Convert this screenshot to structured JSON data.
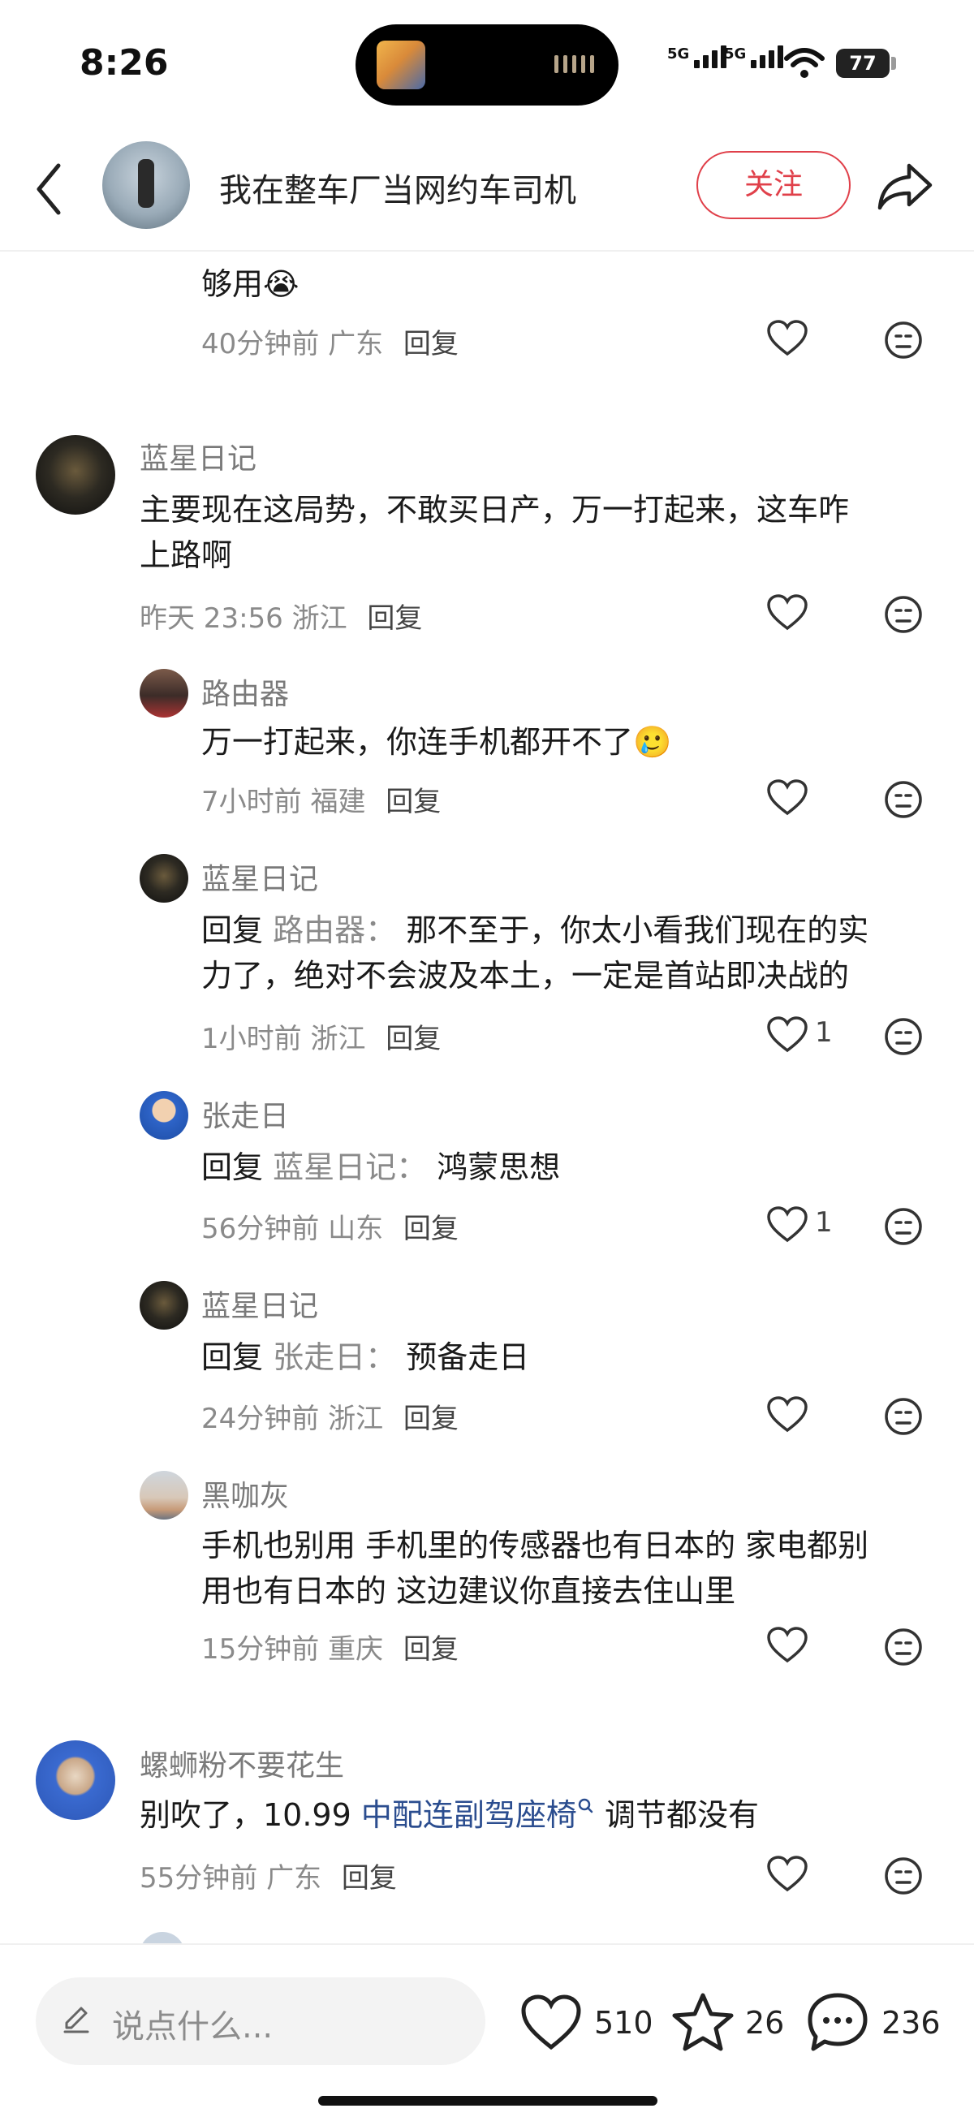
{
  "status_bar": {
    "time": "8:26",
    "signal_1": "5G",
    "signal_2": "5G",
    "battery": "77"
  },
  "header": {
    "title": "我在整车厂当网约车司机",
    "follow_label": "关注"
  },
  "comments": [
    {
      "text": "够用😭",
      "time": "40分钟前",
      "location": "广东",
      "reply_label": "回复"
    },
    {
      "user": "蓝星日记",
      "text_line1": "主要现在这局势，不敢买日产，万一打起来，这车咋",
      "text_line2": "上路啊",
      "time": "昨天 23:56",
      "location": "浙江",
      "reply_label": "回复"
    },
    {
      "user": "路由器",
      "text": "万一打起来，你连手机都开不了🥲",
      "time": "7小时前",
      "location": "福建",
      "reply_label": "回复"
    },
    {
      "user": "蓝星日记",
      "prefix": "回复",
      "target": "路由器：",
      "text_line1": "那不至于，你太小看我们现在的实",
      "text_line2": "力了，绝对不会波及本土，一定是首站即决战的",
      "time": "1小时前",
      "location": "浙江",
      "reply_label": "回复",
      "likes": "1"
    },
    {
      "user": "张走日",
      "prefix": "回复",
      "target": "蓝星日记：",
      "text": "鸿蒙思想",
      "time": "56分钟前",
      "location": "山东",
      "reply_label": "回复",
      "likes": "1"
    },
    {
      "user": "蓝星日记",
      "prefix": "回复",
      "target": "张走日：",
      "text": "预备走日",
      "time": "24分钟前",
      "location": "浙江",
      "reply_label": "回复"
    },
    {
      "user": "黑咖灰",
      "text_line1": "手机也别用 手机里的传感器也有日本的 家电都别",
      "text_line2": "用也有日本的 这边建议你直接去住山里",
      "time": "15分钟前",
      "location": "重庆",
      "reply_label": "回复"
    },
    {
      "user": "螺蛳粉不要花生",
      "text_before": "别吹了，10.99 ",
      "link": "中配连副驾座椅",
      "text_after": " 调节都没有",
      "time": "55分钟前",
      "location": "广东",
      "reply_label": "回复"
    }
  ],
  "bottom_bar": {
    "placeholder": "说点什么...",
    "likes": "510",
    "favorites": "26",
    "comments": "236"
  }
}
